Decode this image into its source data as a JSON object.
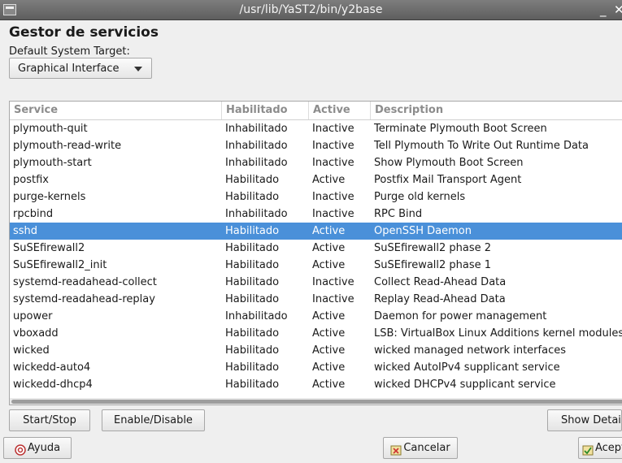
{
  "window": {
    "title": "/usr/lib/YaST2/bin/y2base",
    "minimize_glyph": "_",
    "close_glyph": "✕"
  },
  "page": {
    "title": "Gestor de servicios",
    "target_label": "Default System Target:",
    "target_value": "Graphical Interface"
  },
  "table": {
    "columns": [
      "Service",
      "Habilitado",
      "Active",
      "Description"
    ],
    "selected_row": 6,
    "rows": [
      {
        "service": "plymouth-quit",
        "enabled": "Inhabilitado",
        "active": "Inactive",
        "description": "Terminate Plymouth Boot Screen"
      },
      {
        "service": "plymouth-read-write",
        "enabled": "Inhabilitado",
        "active": "Inactive",
        "description": "Tell Plymouth To Write Out Runtime Data"
      },
      {
        "service": "plymouth-start",
        "enabled": "Inhabilitado",
        "active": "Inactive",
        "description": "Show Plymouth Boot Screen"
      },
      {
        "service": "postfix",
        "enabled": "Habilitado",
        "active": "Active",
        "description": "Postfix Mail Transport Agent"
      },
      {
        "service": "purge-kernels",
        "enabled": "Habilitado",
        "active": "Inactive",
        "description": "Purge old kernels"
      },
      {
        "service": "rpcbind",
        "enabled": "Inhabilitado",
        "active": "Inactive",
        "description": "RPC Bind"
      },
      {
        "service": "sshd",
        "enabled": "Habilitado",
        "active": "Active",
        "description": "OpenSSH Daemon"
      },
      {
        "service": "SuSEfirewall2",
        "enabled": "Habilitado",
        "active": "Active",
        "description": "SuSEfirewall2 phase 2"
      },
      {
        "service": "SuSEfirewall2_init",
        "enabled": "Habilitado",
        "active": "Active",
        "description": "SuSEfirewall2 phase 1"
      },
      {
        "service": "systemd-readahead-collect",
        "enabled": "Habilitado",
        "active": "Inactive",
        "description": "Collect Read-Ahead Data"
      },
      {
        "service": "systemd-readahead-replay",
        "enabled": "Habilitado",
        "active": "Inactive",
        "description": "Replay Read-Ahead Data"
      },
      {
        "service": "upower",
        "enabled": "Inhabilitado",
        "active": "Active",
        "description": "Daemon for power management"
      },
      {
        "service": "vboxadd",
        "enabled": "Habilitado",
        "active": "Active",
        "description": "LSB: VirtualBox Linux Additions kernel modules"
      },
      {
        "service": "wicked",
        "enabled": "Habilitado",
        "active": "Active",
        "description": "wicked managed network interfaces"
      },
      {
        "service": "wickedd-auto4",
        "enabled": "Habilitado",
        "active": "Active",
        "description": "wicked AutoIPv4 supplicant service"
      },
      {
        "service": "wickedd-dhcp4",
        "enabled": "Habilitado",
        "active": "Active",
        "description": "wicked DHCPv4 supplicant service"
      }
    ]
  },
  "actions": {
    "start_stop": "Start/Stop",
    "enable_disable": "Enable/Disable",
    "show_details": "Show Details"
  },
  "footer": {
    "help": "Ayuda",
    "help_icon": "help-icon",
    "cancel": "Cancelar",
    "cancel_icon": "cancel-icon",
    "accept": "Aceptar",
    "accept_icon": "accept-icon"
  },
  "colors": {
    "selection": "#4a90d9",
    "titlebar": "#6a6a6a"
  }
}
